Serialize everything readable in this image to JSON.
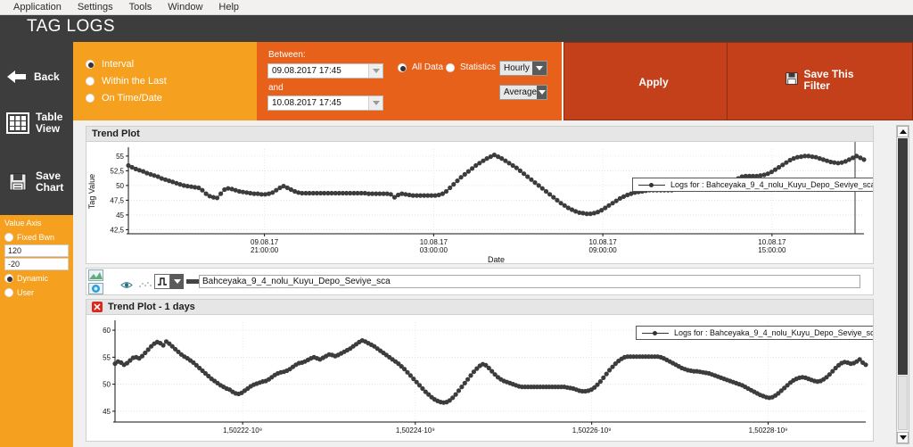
{
  "menubar": {
    "items": [
      {
        "label": "Application"
      },
      {
        "label": "Settings"
      },
      {
        "label": "Tools"
      },
      {
        "label": "Window"
      },
      {
        "label": "Help"
      }
    ]
  },
  "header": {
    "title": "TAG LOGS"
  },
  "sidebar": {
    "back_label": "Back",
    "table_view_label_1": "Table",
    "table_view_label_2": "View",
    "save_chart_label_1": "Save",
    "save_chart_label_2": "Chart",
    "value_axis": {
      "title": "Value Axis",
      "fixed_label": "Fixed Bwn",
      "max_value": "120",
      "min_value": "-20",
      "dynamic_label": "Dynamic",
      "user_label": "User",
      "selected": "Dynamic"
    }
  },
  "filter": {
    "interval": {
      "option_interval": "Interval",
      "option_within_last": "Within the Last",
      "option_on_time_date": "On Time/Date",
      "selected": "Interval"
    },
    "between": {
      "label_between": "Between:",
      "label_and": "and",
      "start_value": "09.08.2017 17:45",
      "end_value": "10.08.2017 17:45"
    },
    "stats": {
      "all_data_label": "All Data",
      "statistics_label": "Statistics",
      "selected": "All Data",
      "period_value": "Hourly",
      "aggregate_value": "Average"
    },
    "apply_label": "Apply",
    "save_filter_label_1": "Save This",
    "save_filter_label_2": "Filter"
  },
  "trend_top": {
    "card_title": "Trend Plot",
    "legend_label": "Logs for : Bahceyaka_9_4_nolu_Kuyu_Depo_Seviye_sca"
  },
  "toolbar": {
    "tag_name": "Bahceyaka_9_4_nolu_Kuyu_Depo_Seviye_sca"
  },
  "trend_bottom": {
    "card_title": "Trend Plot - 1 days",
    "legend_label": "Logs for : Bahceyaka_9_4_nolu_Kuyu_Depo_Seviye_sca"
  },
  "colors": {
    "orange_light": "#F5A01E",
    "orange_dark": "#E8611A",
    "red_button": "#C4401A",
    "dark_panel": "#3D3D3D",
    "series": "#3C3C3C"
  },
  "chart_data": [
    {
      "type": "scatter",
      "title": "Trend Plot",
      "xlabel": "Date",
      "ylabel": "Tag Value",
      "ylim": [
        41.8,
        56.2
      ],
      "yticks": [
        42.5,
        45,
        47.5,
        50,
        52.5,
        55
      ],
      "ytick_labels": [
        "42,5",
        "45",
        "47,5",
        "50",
        "52,5",
        "55"
      ],
      "xtick_labels": [
        "09.08.17\n21:00:00",
        "10.08.17\n03:00:00",
        "10.08.17\n09:00:00",
        "10.08.17\n15:00:00"
      ],
      "xtick_positions": [
        0.185,
        0.415,
        0.645,
        0.875
      ],
      "grid": true,
      "legend_position": "top-right",
      "series": [
        {
          "name": "Logs for : Bahceyaka_9_4_nolu_Kuyu_Depo_Seviye_sca",
          "color": "#3C3C3C",
          "values": [
            53.4,
            53.1,
            52.8,
            52.6,
            52.4,
            52.1,
            51.9,
            51.7,
            51.5,
            51.2,
            51.0,
            50.8,
            50.6,
            50.4,
            50.2,
            50.0,
            49.9,
            49.8,
            49.7,
            49.6,
            49.2,
            48.6,
            48.2,
            48.0,
            47.9,
            48.6,
            49.3,
            49.5,
            49.4,
            49.2,
            49.0,
            48.9,
            48.8,
            48.7,
            48.6,
            48.6,
            48.5,
            48.5,
            48.6,
            48.8,
            49.2,
            49.6,
            49.9,
            49.6,
            49.3,
            49.0,
            48.8,
            48.7,
            48.7,
            48.7,
            48.7,
            48.7,
            48.7,
            48.7,
            48.7,
            48.7,
            48.7,
            48.7,
            48.7,
            48.7,
            48.7,
            48.7,
            48.7,
            48.7,
            48.7,
            48.6,
            48.6,
            48.6,
            48.6,
            48.6,
            48.6,
            48.5,
            48.0,
            48.4,
            48.6,
            48.5,
            48.4,
            48.3,
            48.3,
            48.3,
            48.3,
            48.3,
            48.3,
            48.3,
            48.4,
            48.6,
            49.0,
            49.6,
            50.2,
            50.8,
            51.4,
            51.9,
            52.4,
            52.9,
            53.4,
            53.8,
            54.2,
            54.6,
            54.9,
            55.2,
            54.9,
            54.6,
            54.2,
            53.8,
            53.4,
            53.0,
            52.5,
            52.0,
            51.5,
            51.0,
            50.5,
            50.0,
            49.5,
            49.0,
            48.5,
            48.0,
            47.5,
            47.0,
            46.6,
            46.2,
            45.9,
            45.6,
            45.4,
            45.3,
            45.2,
            45.2,
            45.3,
            45.5,
            45.8,
            46.2,
            46.6,
            47.0,
            47.4,
            47.8,
            48.1,
            48.4,
            48.6,
            48.8,
            48.9,
            49.0,
            49.1,
            49.2,
            49.2,
            49.2,
            49.2,
            49.2,
            49.2,
            49.2,
            49.3,
            49.4,
            49.6,
            49.8,
            50.0,
            50.1,
            50.2,
            50.2,
            50.2,
            50.2,
            50.2,
            50.2,
            50.2,
            50.3,
            50.4,
            50.6,
            50.9,
            51.2,
            51.5,
            51.6,
            51.6,
            51.6,
            51.6,
            51.7,
            51.8,
            52.0,
            52.3,
            52.7,
            53.1,
            53.5,
            53.9,
            54.3,
            54.6,
            54.8,
            54.9,
            55.0,
            55.0,
            54.9,
            54.8,
            54.6,
            54.4,
            54.2,
            54.0,
            53.9,
            53.8,
            53.9,
            54.1,
            54.4,
            54.7,
            55.0,
            54.7,
            54.4
          ]
        }
      ]
    },
    {
      "type": "scatter",
      "title": "Trend Plot - 1 days",
      "xlabel": "",
      "ylabel": "",
      "ylim": [
        43.0,
        61.5
      ],
      "yticks": [
        45,
        50,
        55,
        60
      ],
      "ytick_labels": [
        "45",
        "50",
        "55",
        "60"
      ],
      "xtick_labels": [
        "1,50222·10⁹",
        "1,50224·10⁹",
        "1,50226·10⁹",
        "1,50228·10⁹"
      ],
      "xtick_positions": [
        0.17,
        0.4,
        0.635,
        0.87
      ],
      "grid": true,
      "legend_position": "top-right",
      "series": [
        {
          "name": "Logs for : Bahceyaka_9_4_nolu_Kuyu_Depo_Seviye_sca",
          "color": "#3C3C3C",
          "values": [
            53.8,
            54.2,
            54.0,
            53.6,
            53.9,
            54.4,
            54.9,
            55.0,
            54.8,
            55.2,
            55.8,
            56.4,
            57.0,
            57.5,
            57.8,
            57.6,
            57.2,
            57.9,
            57.5,
            57.0,
            56.5,
            56.0,
            55.5,
            55.1,
            54.8,
            54.4,
            54.0,
            53.5,
            53.0,
            52.5,
            52.0,
            51.5,
            51.0,
            50.6,
            50.2,
            49.8,
            49.5,
            49.2,
            49.0,
            48.6,
            48.3,
            48.2,
            48.4,
            48.8,
            49.2,
            49.6,
            49.9,
            50.1,
            50.3,
            50.5,
            50.6,
            50.9,
            51.3,
            51.7,
            52.0,
            52.2,
            52.3,
            52.5,
            52.8,
            53.2,
            53.6,
            53.9,
            54.0,
            54.2,
            54.5,
            54.8,
            55.0,
            54.8,
            54.6,
            54.9,
            55.2,
            55.5,
            55.4,
            55.2,
            55.4,
            55.7,
            56.0,
            56.3,
            56.6,
            57.0,
            57.4,
            57.8,
            58.1,
            57.9,
            57.6,
            57.3,
            57.0,
            56.6,
            56.2,
            55.8,
            55.4,
            55.0,
            54.6,
            54.2,
            53.8,
            53.3,
            52.8,
            52.2,
            51.6,
            51.0,
            50.4,
            49.8,
            49.2,
            48.6,
            48.1,
            47.6,
            47.2,
            46.9,
            46.7,
            46.6,
            46.7,
            47.0,
            47.5,
            48.1,
            48.8,
            49.5,
            50.2,
            50.9,
            51.6,
            52.3,
            52.9,
            53.4,
            53.7,
            53.5,
            53.0,
            52.4,
            51.8,
            51.3,
            50.9,
            50.6,
            50.4,
            50.2,
            50.0,
            49.8,
            49.6,
            49.5,
            49.5,
            49.5,
            49.5,
            49.5,
            49.5,
            49.5,
            49.5,
            49.5,
            49.5,
            49.5,
            49.5,
            49.5,
            49.5,
            49.5,
            49.4,
            49.3,
            49.2,
            49.0,
            48.8,
            48.7,
            48.7,
            48.8,
            49.0,
            49.4,
            49.9,
            50.5,
            51.2,
            51.9,
            52.6,
            53.2,
            53.8,
            54.3,
            54.7,
            55.0,
            55.1,
            55.1,
            55.1,
            55.1,
            55.1,
            55.1,
            55.1,
            55.1,
            55.1,
            55.1,
            55.1,
            55.0,
            54.8,
            54.5,
            54.2,
            53.9,
            53.6,
            53.3,
            53.0,
            52.8,
            52.6,
            52.5,
            52.4,
            52.4,
            52.3,
            52.2,
            52.1,
            52.0,
            51.8,
            51.6,
            51.4,
            51.2,
            51.0,
            50.8,
            50.6,
            50.4,
            50.2,
            50.0,
            49.8,
            49.5,
            49.2,
            48.9,
            48.6,
            48.3,
            48.0,
            47.8,
            47.6,
            47.5,
            47.6,
            47.9,
            48.3,
            48.8,
            49.3,
            49.8,
            50.3,
            50.7,
            51.0,
            51.2,
            51.3,
            51.2,
            51.0,
            50.8,
            50.6,
            50.5,
            50.6,
            50.9,
            51.3,
            51.8,
            52.4,
            53.0,
            53.5,
            53.9,
            54.1,
            54.0,
            53.8,
            53.9,
            54.2,
            54.6,
            54.0,
            53.6
          ]
        }
      ]
    }
  ]
}
